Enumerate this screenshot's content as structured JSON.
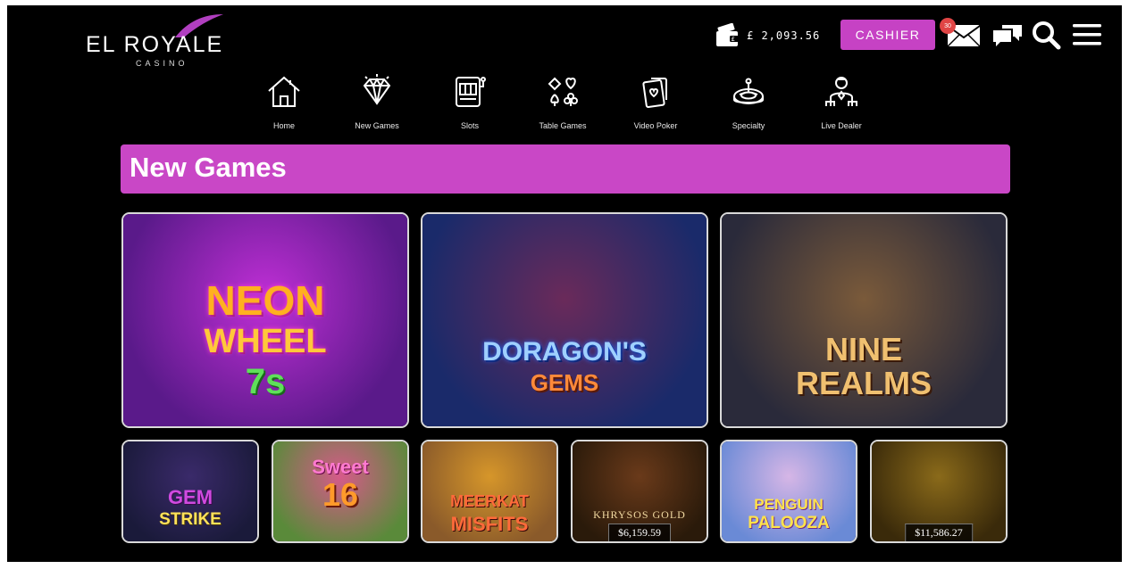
{
  "brand": {
    "name": "EL ROYALE",
    "sub": "CASINO"
  },
  "header": {
    "balance": "£ 2,093.56",
    "cashier_label": "CASHIER",
    "mail_badge": "30"
  },
  "nav": [
    {
      "label": "Home",
      "icon": "home-icon"
    },
    {
      "label": "New Games",
      "icon": "diamond-icon"
    },
    {
      "label": "Slots",
      "icon": "slot-machine-icon"
    },
    {
      "label": "Table Games",
      "icon": "card-suits-icon"
    },
    {
      "label": "Video Poker",
      "icon": "playing-cards-icon"
    },
    {
      "label": "Specialty",
      "icon": "roulette-icon"
    },
    {
      "label": "Live Dealer",
      "icon": "dealer-icon"
    }
  ],
  "section_title": "New Games",
  "featured_games": [
    {
      "line1": "NEON",
      "line2": "WHEEL",
      "line3": "7s",
      "bg": [
        "#5a1a8a",
        "#c02fd6"
      ]
    },
    {
      "line1": "DORAGON'S",
      "line2": "GEMS",
      "line3": "",
      "bg": [
        "#1a2a6a",
        "#6a2a5a"
      ]
    },
    {
      "line1": "NINE",
      "line2": "REALMS",
      "line3": "",
      "bg": [
        "#2a2a3a",
        "#7a5a3a"
      ]
    }
  ],
  "games": [
    {
      "line1": "GEM",
      "line2": "STRIKE",
      "jackpot": "",
      "bg": [
        "#1a1a3a",
        "#3a2a6a"
      ]
    },
    {
      "line1": "Sweet",
      "line2": "16",
      "jackpot": "",
      "bg": [
        "#5a8a3a",
        "#d65a8a"
      ]
    },
    {
      "line1": "MEERKAT",
      "line2": "MISFITS",
      "jackpot": "",
      "bg": [
        "#8a5a2a",
        "#d6962a"
      ]
    },
    {
      "line1": "KHRYSOS GOLD",
      "line2": "",
      "jackpot": "$6,159.59",
      "bg": [
        "#2a1a0a",
        "#6a3a1a"
      ]
    },
    {
      "line1": "PENGUIN",
      "line2": "PALOOZA",
      "jackpot": "",
      "bg": [
        "#6a8ad6",
        "#d6b6e6"
      ]
    },
    {
      "line1": "",
      "line2": "",
      "jackpot": "$11,586.27",
      "bg": [
        "#3a2a0a",
        "#8a6a1a"
      ]
    }
  ],
  "colors": {
    "accent": "#c947c6",
    "background": "#000000",
    "badge": "#e04545"
  }
}
